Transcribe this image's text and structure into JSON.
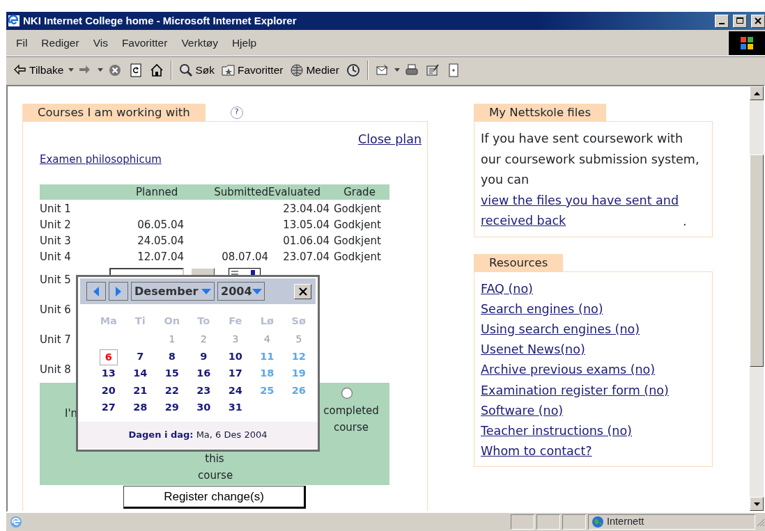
{
  "window": {
    "title": "NKI Internet College home - Microsoft Internet Explorer"
  },
  "menu": [
    {
      "label": "Fil"
    },
    {
      "label": "Rediger"
    },
    {
      "label": "Vis"
    },
    {
      "label": "Favoritter"
    },
    {
      "label": "Verktøy"
    },
    {
      "label": "Hjelp"
    }
  ],
  "toolbar": [
    {
      "kind": "back",
      "label": "Tilbake",
      "dropdown": true
    },
    {
      "kind": "forward",
      "dropdown": true
    },
    {
      "kind": "stop",
      "dropdown": false
    },
    {
      "kind": "refresh",
      "dropdown": false
    },
    {
      "kind": "home",
      "dropdown": false
    },
    {
      "kind": "separator"
    },
    {
      "kind": "search",
      "label": "Søk",
      "dropdown": false
    },
    {
      "kind": "favorites",
      "label": "Favoritter",
      "dropdown": false
    },
    {
      "kind": "media",
      "label": "Medier",
      "dropdown": false
    },
    {
      "kind": "history",
      "dropdown": false
    },
    {
      "kind": "separator"
    },
    {
      "kind": "mail",
      "dropdown": true
    },
    {
      "kind": "print",
      "dropdown": false
    },
    {
      "kind": "edit",
      "dropdown": false
    },
    {
      "kind": "discuss",
      "dropdown": false
    }
  ],
  "courses_panel": {
    "tab": "Courses I am working with",
    "help": "?",
    "close_link": "Close plan",
    "course_link": "Examen philosophicum",
    "table": {
      "columns": [
        "Planned",
        "Submitted",
        "Evaluated",
        "Grade"
      ],
      "rows": [
        {
          "kind": "text",
          "unit": "Unit 1",
          "evaluated": "23.04.04",
          "grade": "Godkjent"
        },
        {
          "kind": "text",
          "unit": "Unit 2",
          "planned": "06.05.04",
          "evaluated": "13.05.04",
          "grade": "Godkjent"
        },
        {
          "kind": "text",
          "unit": "Unit 3",
          "planned": "24.05.04",
          "evaluated": "01.06.04",
          "grade": "Godkjent"
        },
        {
          "kind": "text",
          "unit": "Unit 4",
          "planned": "12.07.04",
          "submitted": "08.07.04",
          "evaluated": "23.07.04",
          "grade": "Godkjent"
        },
        {
          "kind": "date_input",
          "unit": "Unit 5"
        },
        {
          "kind": "label",
          "unit": "Unit 6"
        },
        {
          "kind": "label",
          "unit": "Unit 7"
        },
        {
          "kind": "label",
          "unit": "Unit 8"
        }
      ]
    },
    "status_options": [
      {
        "kind": "text",
        "text": "I'n"
      },
      {
        "kind": "text",
        "text": "this course"
      },
      {
        "kind": "radio",
        "text": "completed course",
        "selected": false
      }
    ],
    "register_button": "Register change(s)"
  },
  "calendar": {
    "month": "Desember",
    "year": "2004",
    "weekdays": [
      {
        "label": "Ma"
      },
      {
        "label": "Ti"
      },
      {
        "label": "On"
      },
      {
        "label": "To"
      },
      {
        "label": "Fe"
      },
      {
        "label": "Lø"
      },
      {
        "label": "Sø"
      }
    ],
    "days": [
      {
        "kind": "blank"
      },
      {
        "kind": "blank"
      },
      {
        "kind": "past",
        "label": "1"
      },
      {
        "kind": "past",
        "label": "2"
      },
      {
        "kind": "past",
        "label": "3"
      },
      {
        "kind": "past",
        "label": "4"
      },
      {
        "kind": "past",
        "label": "5"
      },
      {
        "kind": "today",
        "label": "6"
      },
      {
        "kind": "weekday",
        "label": "7"
      },
      {
        "kind": "weekday",
        "label": "8"
      },
      {
        "kind": "weekday",
        "label": "9"
      },
      {
        "kind": "weekday",
        "label": "10"
      },
      {
        "kind": "weekend",
        "label": "11"
      },
      {
        "kind": "weekend",
        "label": "12"
      },
      {
        "kind": "weekday",
        "label": "13"
      },
      {
        "kind": "weekday",
        "label": "14"
      },
      {
        "kind": "weekday",
        "label": "15"
      },
      {
        "kind": "weekday",
        "label": "16"
      },
      {
        "kind": "weekday",
        "label": "17"
      },
      {
        "kind": "weekend",
        "label": "18"
      },
      {
        "kind": "weekend",
        "label": "19"
      },
      {
        "kind": "weekday",
        "label": "20"
      },
      {
        "kind": "weekday",
        "label": "21"
      },
      {
        "kind": "weekday",
        "label": "22"
      },
      {
        "kind": "weekday",
        "label": "23"
      },
      {
        "kind": "weekday",
        "label": "24"
      },
      {
        "kind": "weekend",
        "label": "25"
      },
      {
        "kind": "weekend",
        "label": "26"
      },
      {
        "kind": "weekday",
        "label": "27"
      },
      {
        "kind": "weekday",
        "label": "28"
      },
      {
        "kind": "weekday",
        "label": "29"
      },
      {
        "kind": "weekday",
        "label": "30"
      },
      {
        "kind": "weekday",
        "label": "31"
      }
    ],
    "footer": "**Dagen i dag:** Ma, 6 Des 2004"
  },
  "files_panel": {
    "tab": "My Nettskole files",
    "text": "If you have sent coursework with our coursework submission system, you can ",
    "link": "view the files you have sent and received back",
    "after": "."
  },
  "resources_panel": {
    "tab": "Resources",
    "links": [
      "FAQ (no)",
      "Search engines (no)",
      "Using search engines (no)",
      "Usenet News(no)",
      "Archive previous exams (no)",
      "Examination register form (no)",
      "Software (no)",
      "Teacher instructions (no)",
      "Whom to contact?"
    ]
  },
  "status_bar": {
    "zone": "Internett"
  }
}
